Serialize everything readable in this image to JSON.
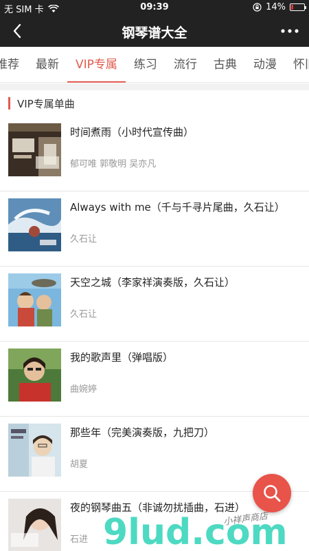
{
  "status": {
    "carrier": "无 SIM 卡",
    "time": "09:39",
    "battery": "14%",
    "battery_level": 0.14
  },
  "nav": {
    "title": "钢琴谱大全"
  },
  "tabs": [
    {
      "label": "推荐"
    },
    {
      "label": "最新"
    },
    {
      "label": "VIP专属"
    },
    {
      "label": "练习"
    },
    {
      "label": "流行"
    },
    {
      "label": "古典"
    },
    {
      "label": "动漫"
    },
    {
      "label": "怀旧"
    }
  ],
  "active_tab": "VIP专属",
  "section": {
    "title": "VIP专属单曲"
  },
  "songs": [
    {
      "name": "时间煮雨（小时代宣传曲）",
      "artist": "郁可唯  郭敬明  吴亦凡"
    },
    {
      "name": "Always with me（千与千寻片尾曲，久石让）",
      "artist": "久石让"
    },
    {
      "name": "天空之城（李家祥演奏版，久石让）",
      "artist": "久石让"
    },
    {
      "name": "我的歌声里（弹唱版）",
      "artist": "曲婉婷"
    },
    {
      "name": "那些年（完美演奏版，九把刀）",
      "artist": "胡夏"
    },
    {
      "name": "夜的钢琴曲五（非诚勿扰插曲，石进）",
      "artist": "石进"
    }
  ],
  "watermark": {
    "text": "9lud.com",
    "handwriting": "小祥声商店"
  },
  "colors": {
    "accent": "#e05a4e",
    "topbar": "#222222",
    "watermark": "#2fd3b8"
  },
  "icons": {
    "back": "chevron-left-icon",
    "more": "more-dots-icon",
    "search": "search-icon"
  }
}
